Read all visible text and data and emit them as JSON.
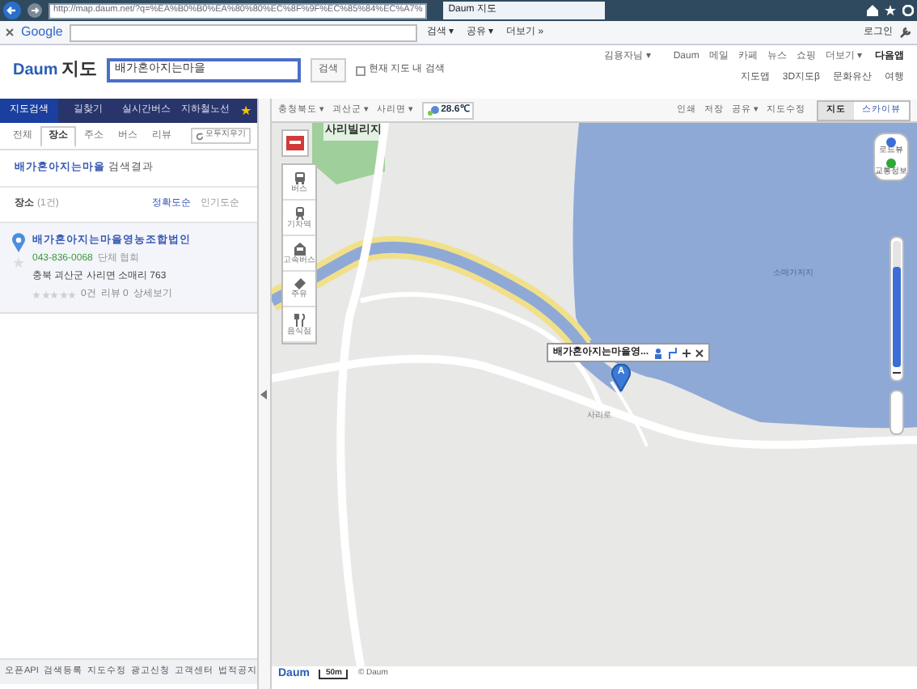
{
  "browser": {
    "url": "http://map.daum.net/?q=%EA%B0%B0%EA%80%80%EC%8F%9F%EC%85%84%EC%A7%",
    "tab": "Daum 지도"
  },
  "toolbar": {
    "brand": "Google",
    "buttons": [
      "검색 ▾",
      "공유 ▾",
      "더보기 »"
    ],
    "login": "로그인"
  },
  "header": {
    "logo_a": "Daum",
    "logo_b": "지도",
    "search_value": "배가혼아지는마을",
    "search_button": "검색",
    "in_map": {
      "label": "현재 지도 내 검색",
      "checked": false
    },
    "user": "김용자님 ▾",
    "links": [
      "Daum",
      "메일",
      "카페",
      "뉴스",
      "쇼핑",
      "더보기 ▾"
    ],
    "app": "다음앱",
    "services": [
      "지도앱",
      "3D지도β",
      "문화유산",
      "여행"
    ]
  },
  "nav_tabs": [
    {
      "label": "지도검색",
      "selected": true
    },
    {
      "label": "길찾기",
      "selected": false
    },
    {
      "label": "실시간버스",
      "selected": false
    },
    {
      "label": "지하철노선",
      "selected": false
    },
    {
      "label": "★",
      "selected": false
    }
  ],
  "sub_tabs": [
    {
      "label": "전체",
      "selected": false
    },
    {
      "label": "장소",
      "selected": true
    },
    {
      "label": "주소",
      "selected": false
    },
    {
      "label": "버스",
      "selected": false
    },
    {
      "label": "리뷰",
      "selected": false
    }
  ],
  "clear_button": "모두지우기",
  "result_title": "**배가혼아지는마을** 검색결과",
  "places": {
    "label": "장소",
    "count": "(1건)",
    "sorts": [
      {
        "label": "정확도순",
        "selected": true
      },
      {
        "label": "인기도순",
        "selected": false
      }
    ]
  },
  "results": [
    {
      "name": "배가혼아지는마을영농조합법인",
      "phone": "043-836-0068",
      "category": "단체 협회",
      "address": "충북 괴산군 사리면 소매리 763",
      "stars": 0,
      "reviews": "0건",
      "review_count": "리뷰 0",
      "detail": "상세보기"
    }
  ],
  "footer": [
    "오픈API",
    "검색등록",
    "지도수정",
    "광고신청",
    "고객센터",
    "법적공지"
  ],
  "map": {
    "regions": [
      "충청북도 ▾",
      "괴산군 ▾",
      "사리면 ▾"
    ],
    "temperature": "28.6℃",
    "actions": [
      "인쇄",
      "저장",
      "공유 ▾",
      "지도수정"
    ],
    "views": [
      {
        "label": "지도",
        "selected": true
      },
      {
        "label": "스카이뷰",
        "selected": false
      }
    ],
    "tools": [
      "버스",
      "기차역",
      "고속버스",
      "주유",
      "음식점"
    ],
    "controls": [
      "로드뷰",
      "교통정보"
    ],
    "labels": [
      {
        "text": "사리빌리지",
        "kind": "place"
      },
      {
        "text": "소매가저지",
        "kind": "water"
      },
      {
        "text": "사리로",
        "kind": "road"
      }
    ],
    "info": {
      "title": "배가혼아지는마을영...",
      "marker": "A"
    },
    "zoom": {
      "level": 0.8
    },
    "scale": "50m",
    "copyright": "© Daum",
    "logo": "Daum"
  }
}
